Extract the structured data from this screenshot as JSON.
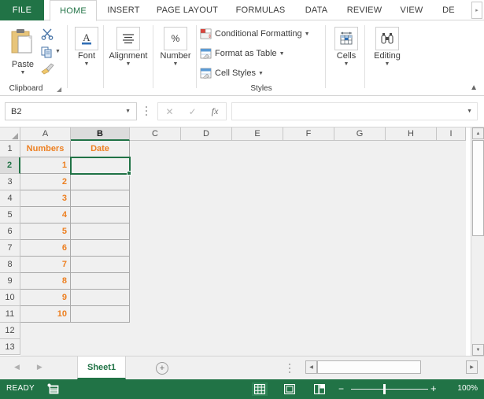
{
  "tabs": {
    "file": "FILE",
    "items": [
      {
        "label": "HOME",
        "active": true
      },
      {
        "label": "INSERT",
        "active": false
      },
      {
        "label": "PAGE LAYOUT",
        "active": false
      },
      {
        "label": "FORMULAS",
        "active": false
      },
      {
        "label": "DATA",
        "active": false
      },
      {
        "label": "REVIEW",
        "active": false
      },
      {
        "label": "VIEW",
        "active": false
      },
      {
        "label": "DE",
        "active": false
      }
    ]
  },
  "ribbon": {
    "clipboard": {
      "group_label": "Clipboard",
      "paste_label": "Paste",
      "cut_label": "Cut",
      "copy_label": "Copy",
      "format_painter_label": "Format Painter"
    },
    "font": {
      "group_label": "Font",
      "button_label": "Font"
    },
    "alignment": {
      "group_label": "Alignment",
      "button_label": "Alignment"
    },
    "number": {
      "group_label": "Number",
      "button_label": "Number"
    },
    "styles": {
      "group_label": "Styles",
      "conditional_formatting": "Conditional Formatting",
      "format_as_table": "Format as Table",
      "cell_styles": "Cell Styles"
    },
    "cells": {
      "group_label": "Cells",
      "button_label": "Cells"
    },
    "editing": {
      "group_label": "Editing",
      "button_label": "Editing"
    }
  },
  "formula_bar": {
    "name_box_value": "B2",
    "cancel_icon": "cancel-icon",
    "enter_icon": "enter-icon",
    "fx_label": "fx",
    "formula_value": ""
  },
  "grid": {
    "columns": [
      "A",
      "B",
      "C",
      "D",
      "E",
      "F",
      "G",
      "H",
      "I"
    ],
    "selected_column": "B",
    "rows": [
      1,
      2,
      3,
      4,
      5,
      6,
      7,
      8,
      9,
      10,
      11,
      12,
      13
    ],
    "selected_row": 2,
    "selected_cell": "B2",
    "cells": {
      "A1": "Numbers",
      "B1": "Date",
      "A2": "1",
      "B2": "",
      "A3": "2",
      "B3": "",
      "A4": "3",
      "B4": "",
      "A5": "4",
      "B5": "",
      "A6": "5",
      "B6": "",
      "A7": "6",
      "B7": "",
      "A8": "7",
      "B8": "",
      "A9": "8",
      "B9": "",
      "A10": "9",
      "B10": "",
      "A11": "10",
      "B11": ""
    },
    "header_text_color": "#ED8022",
    "number_text_color": "#ED8022",
    "selection_color": "#217346"
  },
  "sheet_tabs": {
    "prev_icon": "prev-sheet-icon",
    "next_icon": "next-sheet-icon",
    "sheets": [
      "Sheet1"
    ],
    "active_sheet": "Sheet1",
    "add_sheet_label": "+"
  },
  "status_bar": {
    "status": "READY",
    "macro_icon": "record-macro-icon",
    "views": [
      "normal-view-icon",
      "page-layout-icon",
      "page-break-icon"
    ],
    "active_view": "normal-view-icon",
    "zoom_out_label": "−",
    "zoom_in_label": "+",
    "zoom_value": "100%"
  },
  "colors": {
    "brand_green": "#217346",
    "orange": "#ED8022",
    "grid_bg": "#f0f0f0"
  }
}
